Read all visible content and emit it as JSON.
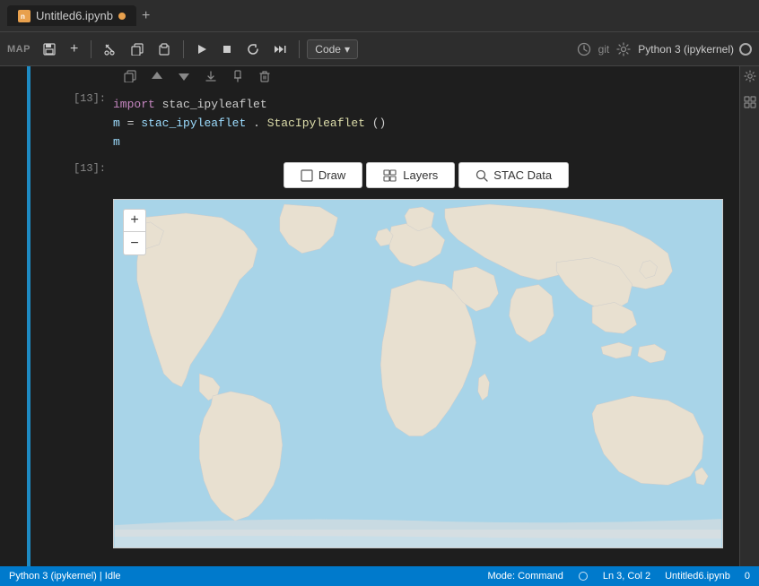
{
  "titlebar": {
    "tab_name": "Untitled6.ipynb",
    "tab_dot_color": "#e8a04d",
    "add_tab_label": "+"
  },
  "toolbar": {
    "map_label": "MAP",
    "save_icon": "💾",
    "add_icon": "+",
    "cut_icon": "✂",
    "copy_icon": "⧉",
    "paste_icon": "📋",
    "run_icon": "▶",
    "stop_icon": "■",
    "restart_icon": "↺",
    "skip_icon": "⏭",
    "code_label": "Code",
    "chevron": "▾",
    "clock_icon": "🕐",
    "git_label": "git",
    "gear_icon": "⚙",
    "kernel_label": "Python 3 (ipykernel)"
  },
  "cell": {
    "input_prompt": "[13]:",
    "output_prompt": "[13]:",
    "line1": "import stac_ipyleaflet",
    "line2": "m = stac_ipyleaflet.StacIpyleaflet()",
    "line3": "m",
    "line1_parts": {
      "keyword": "import",
      "module": "stac_ipyleaflet"
    },
    "line2_parts": {
      "var": "m",
      "assign": " = ",
      "module": "stac_ipyleaflet",
      "dot": ".",
      "func": "StacIpyleaflet",
      "parens": "()"
    }
  },
  "cell_toolbar": {
    "copy_icon": "⧉",
    "up_icon": "↑",
    "down_icon": "↓",
    "export_icon": "⤓",
    "pin_icon": "📌",
    "delete_icon": "🗑"
  },
  "map_buttons": {
    "draw_icon": "⬜",
    "draw_label": "Draw",
    "layers_icon": "⊞",
    "layers_label": "Layers",
    "stac_icon": "🔍",
    "stac_label": "STAC Data"
  },
  "map": {
    "zoom_plus": "+",
    "zoom_minus": "−"
  },
  "status_bar": {
    "kernel_info": "Python 3 (ipykernel) | Idle",
    "mode": "Mode: Command",
    "cursor": "Ln 3, Col 2",
    "filename": "Untitled6.ipynb",
    "spaces": "0"
  }
}
